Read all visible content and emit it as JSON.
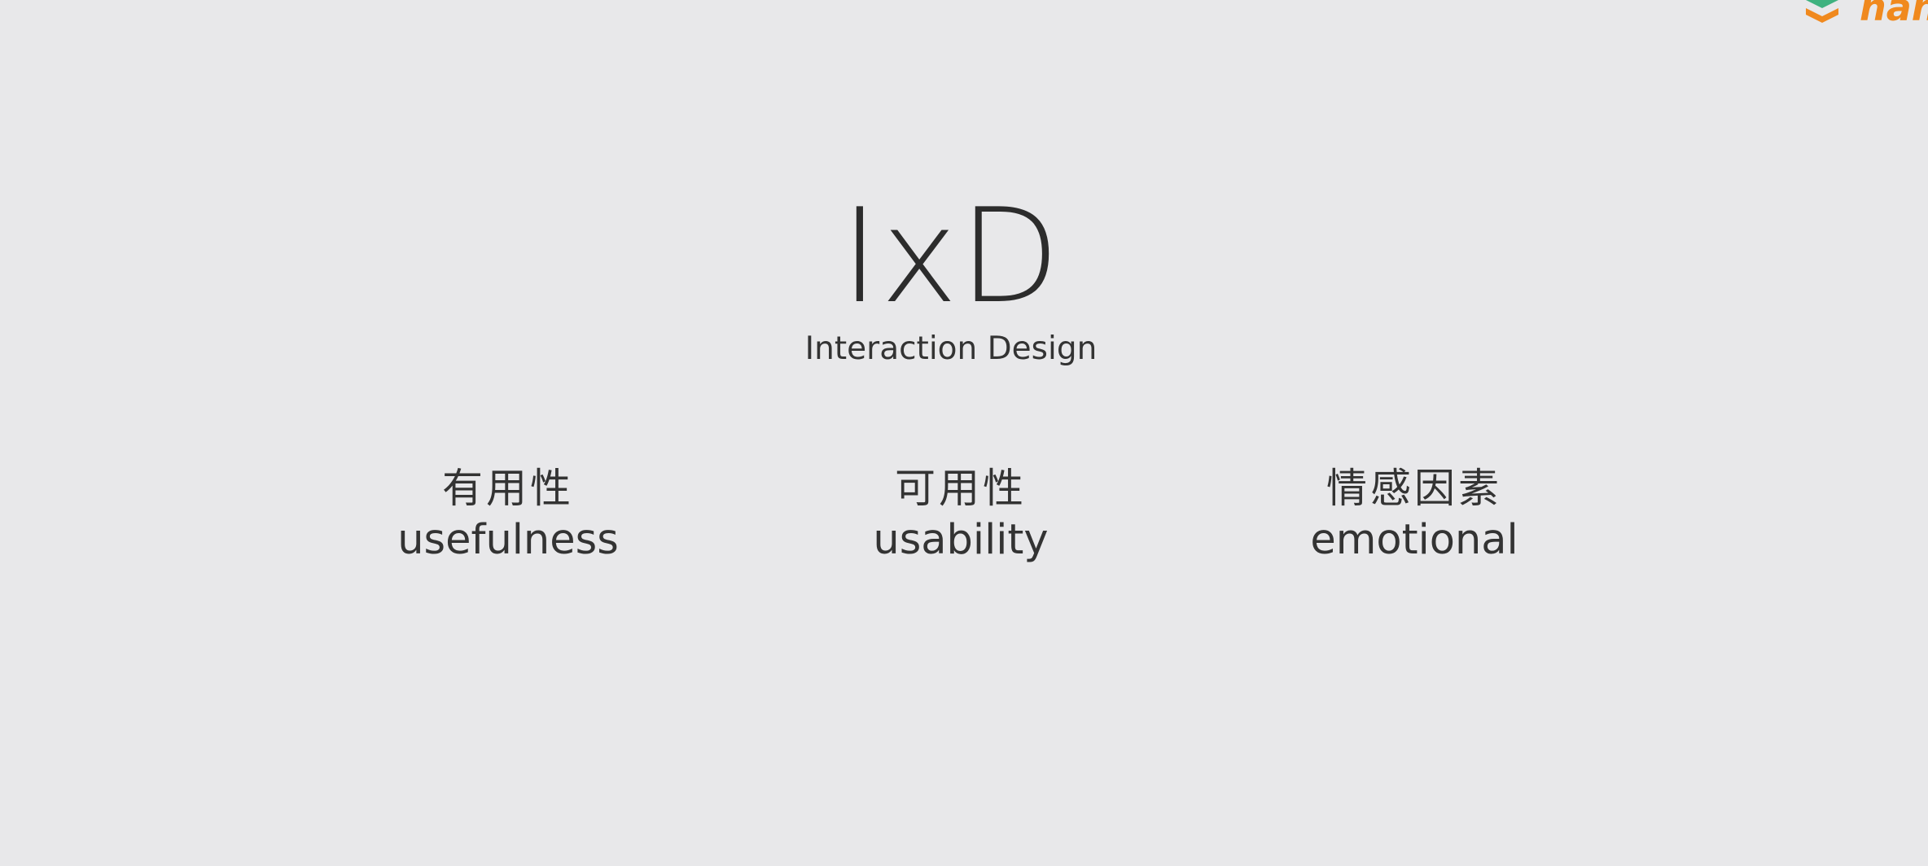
{
  "logo": {
    "text": "hahe",
    "colors": {
      "green": "#3fb27f",
      "orange": "#f0891e"
    }
  },
  "slide": {
    "title": "IxD",
    "subtitle": "Interaction Design",
    "pillars": [
      {
        "zh": "有用性",
        "en": "usefulness"
      },
      {
        "zh": "可用性",
        "en": "usability"
      },
      {
        "zh": "情感因素",
        "en": "emotional"
      }
    ]
  },
  "colors": {
    "background": "#e8e8ea",
    "text": "#333333"
  }
}
